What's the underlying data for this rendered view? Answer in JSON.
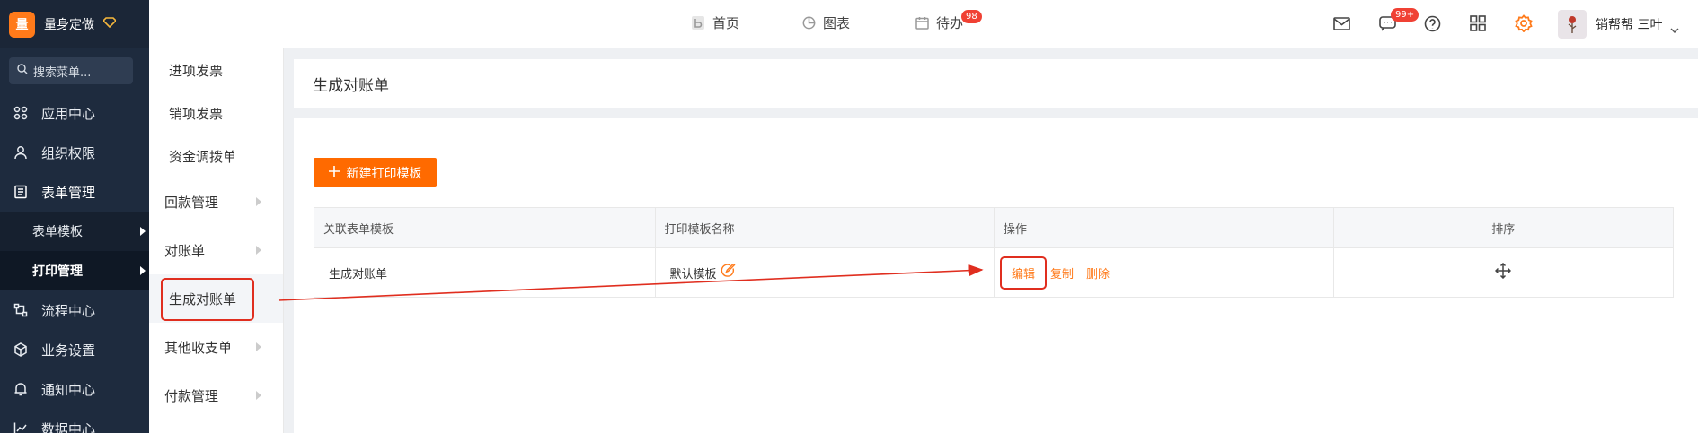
{
  "brand": {
    "logo_char": "量",
    "name": "量身定做"
  },
  "search": {
    "placeholder": "搜索菜单..."
  },
  "sidebar": {
    "items": [
      {
        "label": "应用中心",
        "icon": "apps-icon"
      },
      {
        "label": "组织权限",
        "icon": "user-icon"
      },
      {
        "label": "表单管理",
        "icon": "form-icon"
      },
      {
        "label": "流程中心",
        "icon": "flow-icon"
      },
      {
        "label": "业务设置",
        "icon": "cube-icon"
      },
      {
        "label": "通知中心",
        "icon": "bell-icon"
      },
      {
        "label": "数据中心",
        "icon": "chart-icon"
      }
    ],
    "subitems": [
      {
        "label": "表单模板"
      },
      {
        "label": "打印管理"
      }
    ]
  },
  "submenu": {
    "items": [
      {
        "label": "进项发票"
      },
      {
        "label": "销项发票"
      },
      {
        "label": "资金调拨单"
      },
      {
        "label": "回款管理"
      },
      {
        "label": "对账单"
      },
      {
        "label": "生成对账单"
      },
      {
        "label": "其他收支单"
      },
      {
        "label": "付款管理"
      }
    ]
  },
  "topbar": {
    "nav": [
      {
        "label": "首页",
        "icon": "home-b-icon"
      },
      {
        "label": "图表",
        "icon": "pie-icon"
      },
      {
        "label": "待办",
        "icon": "calendar-icon",
        "badge": "98"
      }
    ],
    "message_badge": "99+",
    "username": "销帮帮 三叶"
  },
  "page": {
    "title": "生成对账单"
  },
  "content": {
    "new_button": "新建打印模板",
    "table": {
      "headers": [
        "关联表单模板",
        "打印模板名称",
        "操作",
        "排序"
      ],
      "rows": [
        {
          "form": "生成对账单",
          "template": "默认模板",
          "actions": [
            "编辑",
            "复制",
            "删除"
          ]
        }
      ]
    }
  },
  "colors": {
    "accent": "#ff6a00",
    "sidebar_bg": "#1e2b3e",
    "highlight": "#e02e1f"
  }
}
